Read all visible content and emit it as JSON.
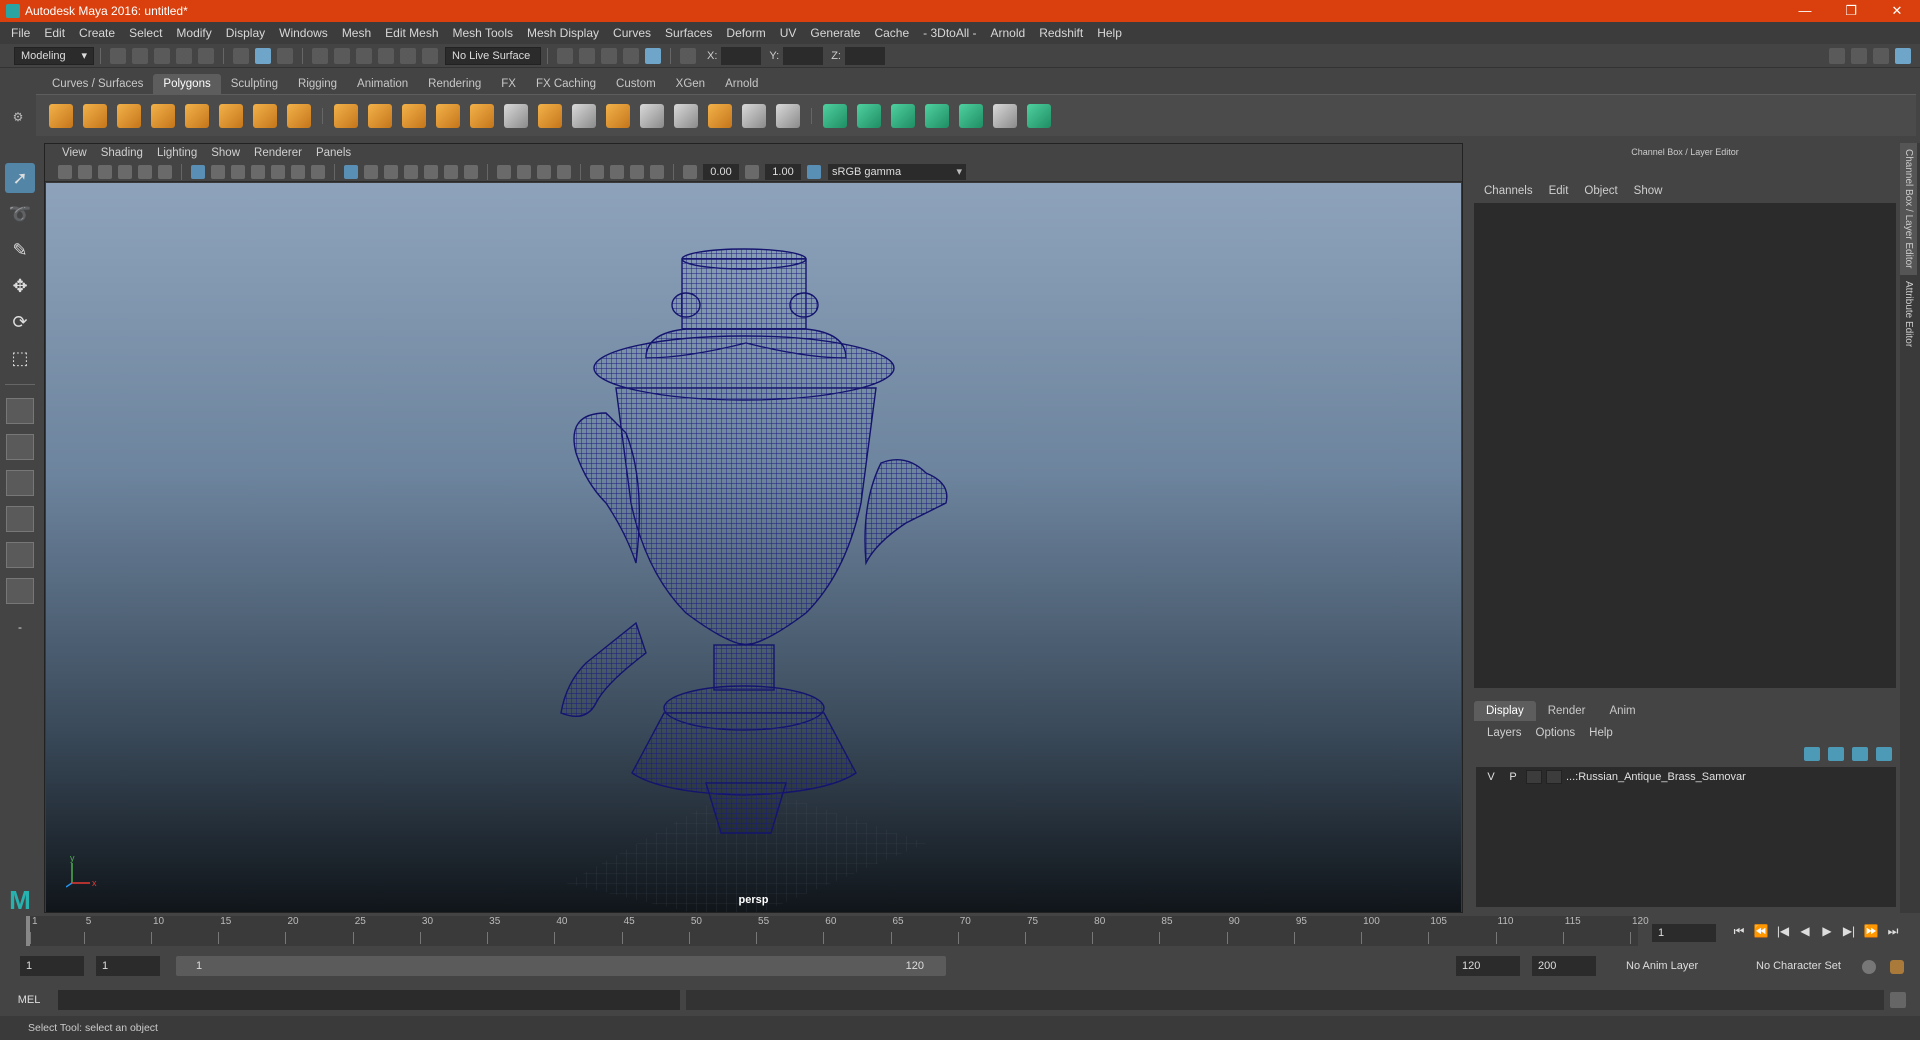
{
  "window": {
    "title": "Autodesk Maya 2016: untitled*",
    "minimize": "—",
    "restore": "❐",
    "close": "✕"
  },
  "menubar": [
    "File",
    "Edit",
    "Create",
    "Select",
    "Modify",
    "Display",
    "Windows",
    "Mesh",
    "Edit Mesh",
    "Mesh Tools",
    "Mesh Display",
    "Curves",
    "Surfaces",
    "Deform",
    "UV",
    "Generate",
    "Cache",
    "- 3DtoAll -",
    "Arnold",
    "Redshift",
    "Help"
  ],
  "statusline": {
    "menuset": "Modeling",
    "live_surface": "No Live Surface",
    "x_label": "X:",
    "y_label": "Y:",
    "z_label": "Z:"
  },
  "shelf_tabs": [
    "Curves / Surfaces",
    "Polygons",
    "Sculpting",
    "Rigging",
    "Animation",
    "Rendering",
    "FX",
    "FX Caching",
    "Custom",
    "XGen",
    "Arnold"
  ],
  "shelf_active": "Polygons",
  "panel_menu": [
    "View",
    "Shading",
    "Lighting",
    "Show",
    "Renderer",
    "Panels"
  ],
  "panel_toolbar": {
    "exposure": "0.00",
    "gamma": "1.00",
    "color_space": "sRGB gamma"
  },
  "viewport": {
    "camera": "persp",
    "axis_y": "y",
    "axis_x": "x",
    "axis_z": "z"
  },
  "channel_box": {
    "title": "Channel Box / Layer Editor",
    "menu": [
      "Channels",
      "Edit",
      "Object",
      "Show"
    ],
    "layer_tabs": [
      "Display",
      "Render",
      "Anim"
    ],
    "layer_menu": [
      "Layers",
      "Options",
      "Help"
    ],
    "layer": {
      "visible": "V",
      "playback": "P",
      "name": "...:Russian_Antique_Brass_Samovar"
    },
    "side_tabs": [
      "Channel Box / Layer Editor",
      "Attribute Editor"
    ]
  },
  "timeslider": {
    "ticks": [
      "1",
      "5",
      "10",
      "15",
      "20",
      "25",
      "30",
      "35",
      "40",
      "45",
      "50",
      "55",
      "60",
      "65",
      "70",
      "75",
      "80",
      "85",
      "90",
      "95",
      "100",
      "105",
      "110",
      "115",
      "120"
    ],
    "current_frame": "1",
    "playback_icons": [
      "⏮",
      "⏪",
      "|◀",
      "◀",
      "▶",
      "▶|",
      "⏩",
      "⏭"
    ]
  },
  "rangeslider": {
    "start": "1",
    "playback_start": "1",
    "range_start": "1",
    "range_end": "120",
    "playback_end": "120",
    "end": "200",
    "anim_layer": "No Anim Layer",
    "char_set": "No Character Set"
  },
  "cmdline": {
    "label": "MEL"
  },
  "helpline": "Select Tool: select an object",
  "colors": {
    "titlebar": "#d9400d",
    "accent": "#5285a6",
    "wireframe": "#1a1a80"
  }
}
